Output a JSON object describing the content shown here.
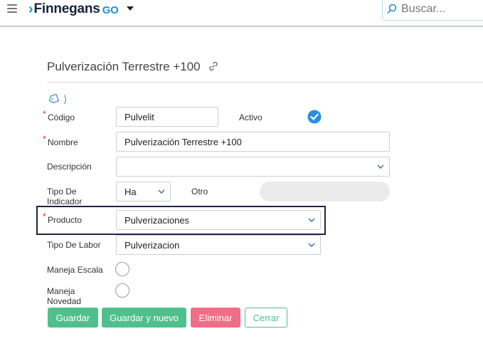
{
  "header": {
    "brand": "Finnegans",
    "brand_suffix": "GO",
    "search_placeholder": "Buscar..."
  },
  "page": {
    "title": "Pulverización Terrestre +100"
  },
  "form": {
    "codigo": {
      "label": "Código",
      "value": "Pulvelit",
      "required": true
    },
    "activo": {
      "label": "Activo",
      "checked": true
    },
    "nombre": {
      "label": "Nombre",
      "value": "Pulverización Terrestre +100",
      "required": true
    },
    "descripcion": {
      "label": "Descripción",
      "value": ""
    },
    "tipo_indicador": {
      "label_line1": "Tipo De",
      "label_line2": "Indicador",
      "value": "Ha"
    },
    "otro": {
      "label": "Otro",
      "value": ""
    },
    "producto": {
      "label": "Producto",
      "value": "Pulverizaciones",
      "required": true
    },
    "tipo_labor": {
      "label": "Tipo De Labor",
      "value": "Pulverizacion"
    },
    "maneja_escala": {
      "label": "Maneja Escala",
      "checked": false
    },
    "maneja_novedad": {
      "label_line1": "Maneja",
      "label_line2": "Novedad",
      "checked": false
    }
  },
  "actions": {
    "guardar": "Guardar",
    "guardar_nuevo": "Guardar y nuevo",
    "eliminar": "Eliminar",
    "cerrar": "Cerrar"
  },
  "colors": {
    "brand_blue": "#1a8fe0",
    "primary_green": "#4fc08d",
    "danger_pink": "#f16d86",
    "required_red": "#e0262a",
    "focus_navy": "#1e2447"
  }
}
